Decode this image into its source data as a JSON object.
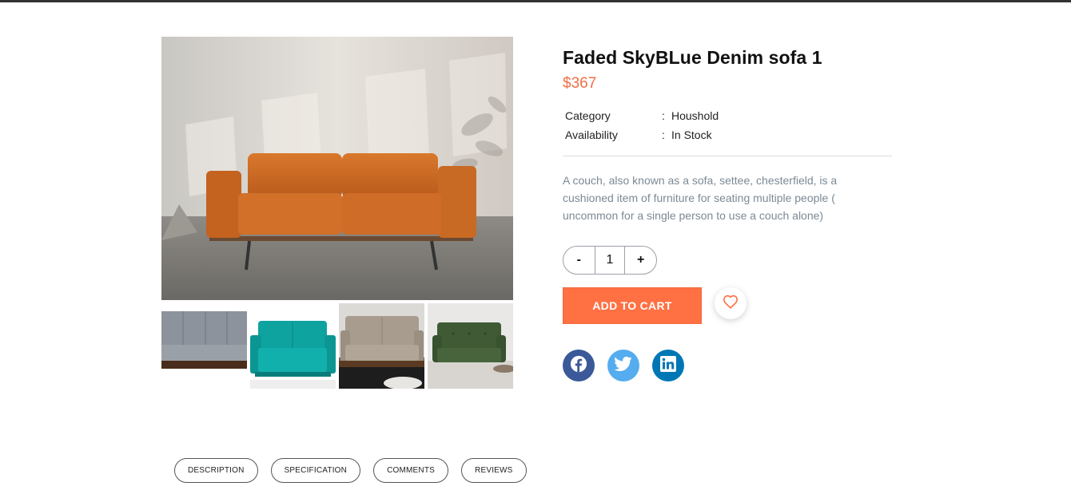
{
  "product": {
    "title": "Faded SkyBLue Denim sofa 1",
    "price": "$367",
    "meta": [
      {
        "key": "Category",
        "colon": ":",
        "value": "Houshold"
      },
      {
        "key": "Availability",
        "colon": ":",
        "value": "In Stock"
      }
    ],
    "description": "A couch, also known as a sofa, settee, chesterfield, is a cushioned item of furniture for seating multiple people ( uncommon for a single person to use a couch alone)"
  },
  "quantity": {
    "minus_label": "-",
    "value": "1",
    "plus_label": "+"
  },
  "actions": {
    "add_to_cart_label": "ADD TO CART",
    "wishlist_icon": "heart-icon"
  },
  "social": [
    {
      "name": "facebook",
      "icon": "facebook-icon",
      "color": "#3b5998"
    },
    {
      "name": "twitter",
      "icon": "twitter-icon",
      "color": "#55acee"
    },
    {
      "name": "linkedin",
      "icon": "linkedin-icon",
      "color": "#0077b5"
    }
  ],
  "gallery": {
    "main_image": "orange leather sofa",
    "thumbnails": [
      "grey fabric sofa",
      "teal sofa",
      "taupe sofa",
      "green sofa"
    ]
  },
  "tabs": [
    {
      "label": "DESCRIPTION"
    },
    {
      "label": "SPECIFICATION"
    },
    {
      "label": "COMMENTS"
    },
    {
      "label": "REVIEWS"
    }
  ],
  "colors": {
    "accent": "#ff7043",
    "price": "#f06f45",
    "description": "#7b8a96"
  }
}
